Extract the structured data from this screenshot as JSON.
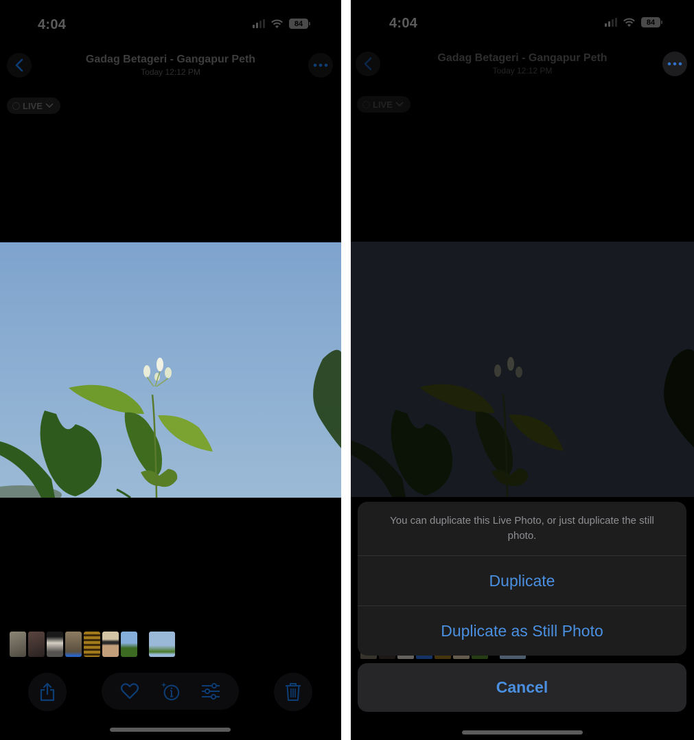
{
  "left_screen": {
    "status_bar": {
      "time": "4:04",
      "battery": "84"
    },
    "header": {
      "title": "Gadag Betageri - Gangapur Peth",
      "subtitle": "Today  12:12 PM"
    },
    "live_badge": {
      "label": "LIVE"
    },
    "photo": {
      "description": "Jasmine plant buds against blue sky",
      "sky_color": "#7fa6cf"
    },
    "thumbnails": [
      "#6b6658",
      "#3a2e2c",
      "#c9c3bb",
      "#7c6c55",
      "#8a6a1c",
      "#c6b79a",
      "#7fa8d4",
      "#9ab8d8"
    ],
    "toolbar": {
      "share": "share-icon",
      "favorite": "heart-icon",
      "info": "info-sparkle-icon",
      "adjust": "sliders-icon",
      "delete": "trash-icon"
    }
  },
  "right_screen": {
    "status_bar": {
      "time": "4:04",
      "battery": "84"
    },
    "header": {
      "title": "Gadag Betageri - Gangapur Peth",
      "subtitle": "Today  12:12 PM"
    },
    "live_badge": {
      "label": "LIVE"
    },
    "action_sheet": {
      "message": "You can duplicate this Live Photo, or just duplicate the still photo.",
      "actions": [
        {
          "label": "Duplicate"
        },
        {
          "label": "Duplicate as Still Photo"
        }
      ],
      "cancel_label": "Cancel",
      "accent_color": "#4a8fe0"
    }
  }
}
